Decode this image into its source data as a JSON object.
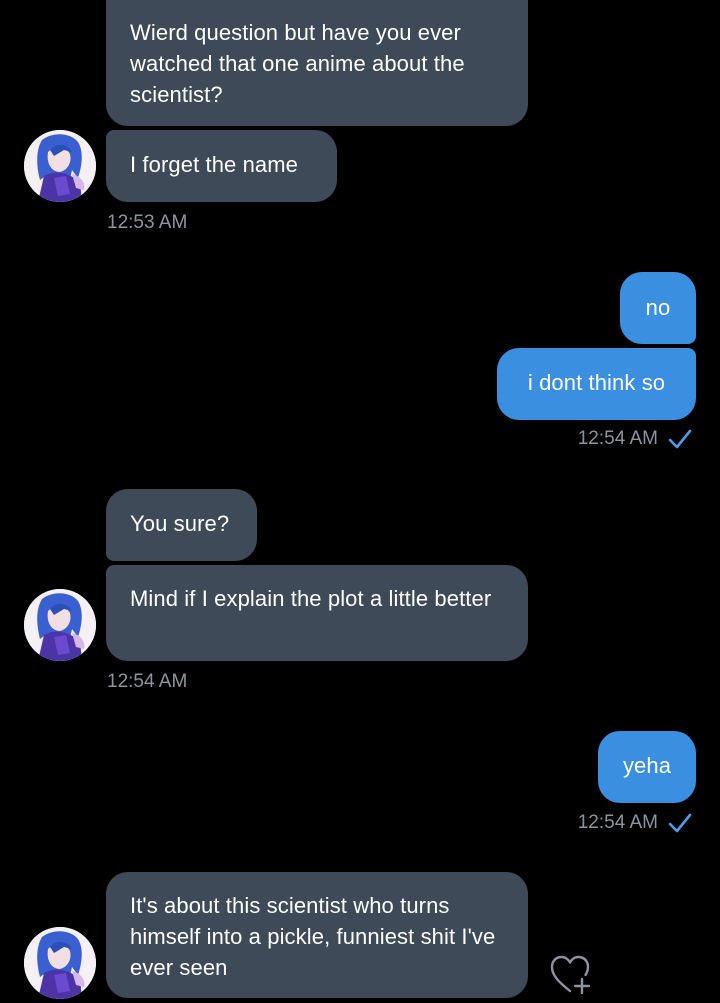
{
  "conversation": {
    "groups": [
      {
        "messages": [
          "Wierd question but have you ever watched that one anime about the scientist?",
          "I forget the name"
        ],
        "time": "12:53 AM"
      },
      {
        "messages": [
          "no",
          "i dont think so"
        ],
        "time": "12:54 AM"
      },
      {
        "messages": [
          "You sure?",
          "Mind if I explain the plot a little better"
        ],
        "time": "12:54 AM"
      },
      {
        "messages": [
          "yeha"
        ],
        "time": "12:54 AM"
      },
      {
        "messages": [
          "It's about this scientist who turns himself into a pickle, funniest shit I've ever seen"
        ]
      }
    ]
  },
  "colors": {
    "background": "#000000",
    "incoming_bubble": "#3e4a57",
    "outgoing_bubble": "#3a8fe0",
    "timestamp": "#8b95a0",
    "read_check": "#4a9fe8"
  },
  "icons": {
    "read_receipt": "check-icon",
    "react": "heart-plus-icon",
    "avatar": "user-avatar"
  }
}
